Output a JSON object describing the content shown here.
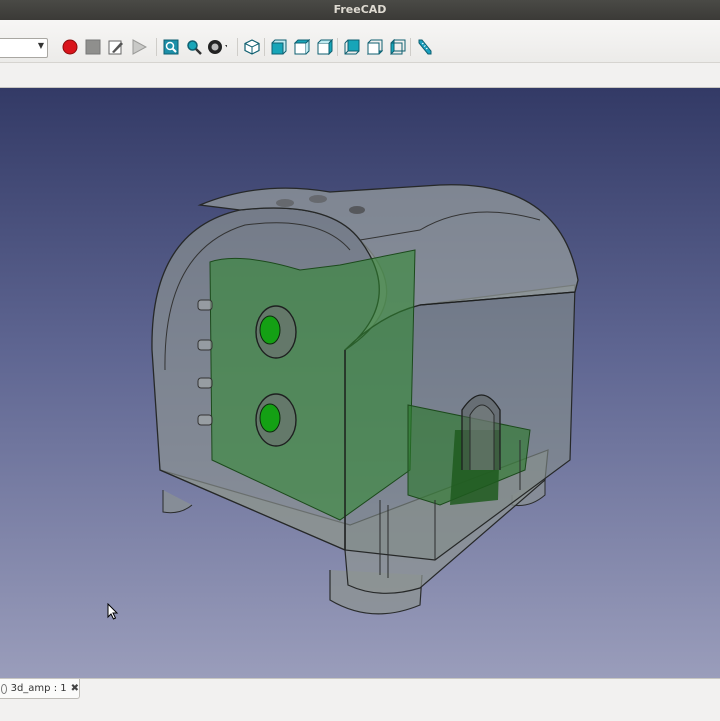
{
  "window": {
    "title": "FreeCAD"
  },
  "toolbar": {
    "workbench_value": "",
    "icons": [
      "macro-record-icon",
      "macro-stop-icon",
      "macro-edit-icon",
      "macro-run-icon",
      "fit-all-icon",
      "fit-selection-icon",
      "draw-style-icon",
      "view-isometric-icon",
      "view-front-icon",
      "view-top-icon",
      "view-right-icon",
      "view-rear-icon",
      "view-bottom-icon",
      "view-left-icon",
      "measure-icon"
    ],
    "colors": {
      "record": "#d9141b",
      "view_cube": "#17a5b8",
      "measure": "#1aa0c0"
    }
  },
  "viewport": {
    "model_name": "3d_amp",
    "background_top": "#333a66",
    "background_bottom": "#9a9dbb",
    "model_colors": {
      "shell": "#7f8a86",
      "inner_part": "#2e8a2e"
    }
  },
  "tabs": [
    {
      "label": "3d_amp : 1"
    }
  ]
}
